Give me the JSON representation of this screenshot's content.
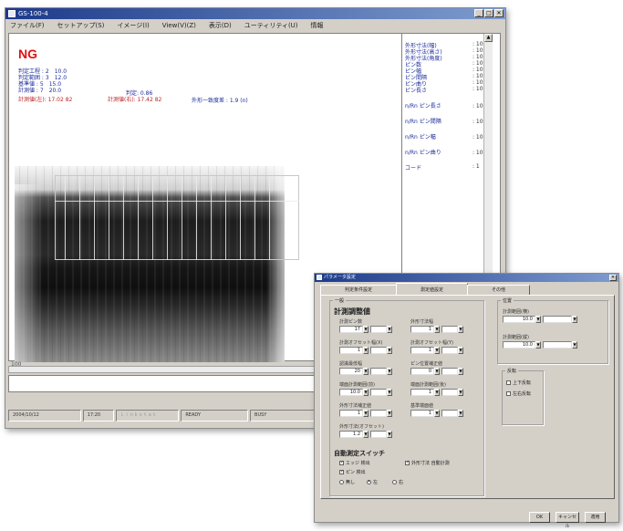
{
  "main_window": {
    "title": "GS-100-4",
    "menu": [
      "ファイル(F)",
      "セットアップ(S)",
      "イメージ(I)",
      "View(V)(Z)",
      "表示(D)",
      "ユーティリティ(U)",
      "情報"
    ],
    "judgement": "NG",
    "params": [
      {
        "label": "判定工程",
        "value": "2",
        "extra": "10.0"
      },
      {
        "label": "判定範囲",
        "value": "3",
        "extra": "12.0"
      },
      {
        "label": "基準値",
        "value": "5",
        "extra": "15.0"
      },
      {
        "label": "計測値",
        "value": "7",
        "extra": "20.0"
      }
    ],
    "measured_left": "計測値(左): 17.02 82",
    "measured_right": "計測値(右): 17.42 82",
    "judge_extra": "判定: 0.86",
    "tolerance": "外形一致度差 : 1.9 (n)",
    "right_panel": [
      {
        "label": "外形寸法(幅)",
        "value": ": 10"
      },
      {
        "label": "外形寸法(高さ)",
        "value": ": 10"
      },
      {
        "label": "外形寸法(角度)",
        "value": ": 10"
      },
      {
        "label": "ピン数",
        "value": ": 10"
      },
      {
        "label": "ピン幅",
        "value": ": 10"
      },
      {
        "label": "ピン間隔",
        "value": ": 10"
      },
      {
        "label": "ピン曲り",
        "value": ": 10"
      },
      {
        "label": "ピン長さ",
        "value": ": 10"
      },
      {
        "label": "n/Rn ピン長さ",
        "value": ": 10〜"
      },
      {
        "label": "n/Rn ピン間隔",
        "value": ": 10〜"
      },
      {
        "label": "n/Rn ピン幅",
        "value": ": 10〜"
      },
      {
        "label": "n/Rn ピン曲り",
        "value": ": 10〜"
      },
      {
        "label": "コード",
        "value": ": 1"
      }
    ],
    "zoom": "100",
    "status": [
      "2004/10/12",
      "17:20",
      "Ｌｉｎｋｓｔａｔ",
      "READY",
      "BUSY"
    ]
  },
  "dialog": {
    "title": "パラメータ設定",
    "tabs": [
      "判定条件設定",
      "測定値設定",
      "その他"
    ],
    "active_tab": 1,
    "group_caption": "一般",
    "heading": "計測調整値",
    "fields": [
      {
        "label": "計測ピン数",
        "value": "17"
      },
      {
        "label": "外形寸法幅",
        "value": "1"
      },
      {
        "label": "計測オフセット幅(X)",
        "value": "1"
      },
      {
        "label": "計測オフセット幅(Y)",
        "value": "1"
      },
      {
        "label": "認識最低幅",
        "value": "20"
      },
      {
        "label": "ピン位置補正値",
        "value": "0"
      },
      {
        "label": "端面計測範囲(前)",
        "value": "10.0"
      },
      {
        "label": "端面計測範囲(後)",
        "value": "1"
      },
      {
        "label": "外形寸法補正値",
        "value": "1"
      },
      {
        "label": "基準端面値",
        "value": "1"
      },
      {
        "label": "外形寸法(オフセット)",
        "value": "1.2"
      }
    ],
    "switch_heading": "自動測定スイッチ",
    "switches": [
      "エッジ 検出",
      "外形寸法 自動計測",
      "ピン 検出"
    ],
    "radio_options": [
      "無し",
      "左",
      "右"
    ],
    "right_group_caption": "位置",
    "right_fields": [
      {
        "label": "計測範囲(横)",
        "value": "10.0"
      },
      {
        "label": "計測範囲(縦)",
        "value": "10.0"
      }
    ],
    "options_caption": "反転",
    "options": [
      "上下反転",
      "左右反転"
    ],
    "buttons": [
      "OK",
      "キャンセル",
      "適用"
    ]
  }
}
